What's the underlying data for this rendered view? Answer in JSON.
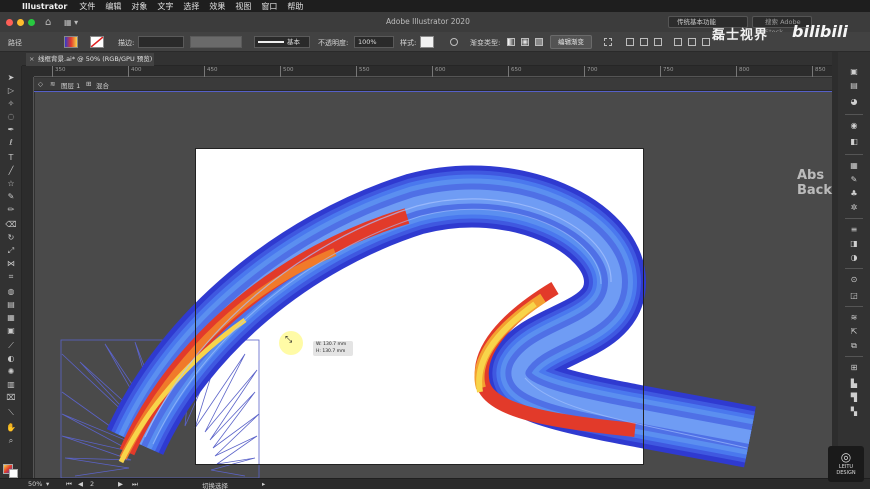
{
  "menubar": {
    "apple": "",
    "app_name": "Illustrator",
    "items": [
      "文件",
      "编辑",
      "对象",
      "文字",
      "选择",
      "效果",
      "视图",
      "窗口",
      "帮助"
    ]
  },
  "titlebar": {
    "app_title": "Adobe Illustrator 2020",
    "workspace": "传统基本功能",
    "search_placeholder": "搜索 Adobe Stock"
  },
  "controlbar": {
    "object_type": "路径",
    "stroke_label": "描边:",
    "stroke_profile": "基本",
    "opacity_label": "不透明度:",
    "opacity_value": "100%",
    "style_label": "样式:",
    "gradient_type_label": "渐变类型:",
    "edit_gradient_button": "编辑渐变"
  },
  "document": {
    "tab_title": "线框背景.ai* @ 50% (RGB/GPU 预览)",
    "close_glyph": "×"
  },
  "ruler": {
    "ticks": [
      "350",
      "400",
      "450",
      "500",
      "550",
      "600",
      "650",
      "700",
      "750",
      "800",
      "850"
    ]
  },
  "isolation": {
    "layer": "图层 1",
    "group": "混合"
  },
  "tooltip": {
    "width": "W: 130.7 mm",
    "height": "H: 130.7 mm"
  },
  "statusbar": {
    "zoom": "50%",
    "artboard_number": "2",
    "status_text": "切换选择"
  },
  "watermarks": {
    "channel_cn": "磊士视界",
    "bilibili": "bilibili",
    "abs_line1": "Abs",
    "abs_line2": "Back",
    "leitu_logo": "LEITU",
    "leitu_sub": "DESIGN"
  },
  "colors": {
    "blend_start": "#2f3ad0",
    "blend_mid": "#e23a2a",
    "blend_end": "#f8d44a",
    "isolation_line": "#5560c8",
    "starburst_stroke": "#5b63c9"
  }
}
